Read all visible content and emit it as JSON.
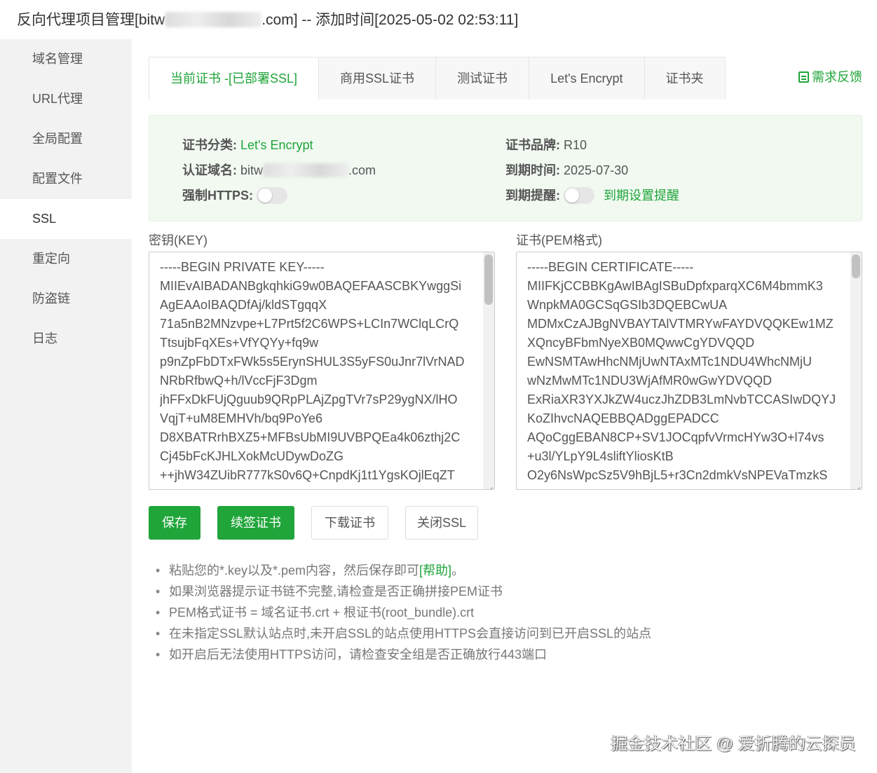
{
  "window": {
    "title_prefix": "反向代理项目管理[bitw",
    "title_suffix": ".com] -- 添加时间[2025-05-02 02:53:11]"
  },
  "sidebar": {
    "items": [
      {
        "label": "域名管理"
      },
      {
        "label": "URL代理"
      },
      {
        "label": "全局配置"
      },
      {
        "label": "配置文件"
      },
      {
        "label": "SSL"
      },
      {
        "label": "重定向"
      },
      {
        "label": "防盗链"
      },
      {
        "label": "日志"
      }
    ],
    "active_index": 4
  },
  "tabs": [
    {
      "label": "当前证书 -[已部署SSL]"
    },
    {
      "label": "商用SSL证书"
    },
    {
      "label": "测试证书"
    },
    {
      "label": "Let's Encrypt"
    },
    {
      "label": "证书夹"
    }
  ],
  "feedback_label": "需求反馈",
  "cert_info": {
    "category_label": "证书分类:",
    "category_value": "Let's Encrypt",
    "brand_label": "证书品牌:",
    "brand_value": "R10",
    "domain_label": "认证域名:",
    "domain_prefix": "bitw",
    "domain_suffix": ".com",
    "expire_label": "到期时间:",
    "expire_value": "2025-07-30",
    "https_label": "强制HTTPS:",
    "https_enabled": false,
    "reminder_label": "到期提醒:",
    "reminder_enabled": false,
    "reminder_link": "到期设置提醒"
  },
  "key_field": {
    "label": "密钥(KEY)",
    "value": "-----BEGIN PRIVATE KEY-----\nMIIEvAIBADANBgkqhkiG9w0BAQEFAASCBKYwggSi\nAgEAAoIBAQDfAj/kldSTgqqX\n71a5nB2MNzvpe+L7Prt5f2C6WPS+LCIn7WClqLCrQ\nTtsujbFqXEs+VfYQYy+fq9w\np9nZpFbDTxFWk5s5ErynSHUL3S5yFS0uJnr7lVrNAD\nNRbRfbwQ+h/lVccFjF3Dgm\njhFFxDkFUjQguub9QRpPLAjZpgTVr7sP29ygNX/lHO\nVqjT+uM8EMHVh/bq9PoYe6\nD8XBATRrhBXZ5+MFBsUbMI9UVBPQEa4k06zthj2C\nCj45bFcKJHLXokMcUDywDoZG\n++jhW34ZUibR777kS0v6Q+CnpdKj1t1YgsKOjlEqZT"
  },
  "cert_field": {
    "label": "证书(PEM格式)",
    "value": "-----BEGIN CERTIFICATE-----\nMIIFKjCCBBKgAwIBAgISBuDpfxparqXC6M4bmmK3\nWnpkMA0GCSqGSIb3DQEBCwUA\nMDMxCzAJBgNVBAYTAlVTMRYwFAYDVQQKEw1MZ\nXQncyBFbmNyeXB0MQwwCgYDVQQD\nEwNSMTAwHhcNMjUwNTAxMTc1NDU4WhcNMjU\nwNzMwMTc1NDU3WjAfMR0wGwYDVQQD\nExRiaXR3YXJkZW4uczJhZDB3LmNvbTCCASIwDQYJ\nKoZIhvcNAQEBBQADggEPADCC\nAQoCggEBAN8CP+SV1JOCqpfvVrmcHYw3O+l74vs\n+u3l/YLpY9L4sliftYliosKtB\nO2y6NsWpcSz5V9hBjL5+r3Cn2dmkVsNPEVaTmzkS"
  },
  "buttons": {
    "save": "保存",
    "renew": "续签证书",
    "download": "下载证书",
    "close_ssl": "关闭SSL"
  },
  "tips": {
    "tip1_text": "粘贴您的*.key以及*.pem内容，然后保存即可",
    "tip1_link": "[帮助]",
    "tip1_end": "。",
    "tip2": "如果浏览器提示证书链不完整,请检查是否正确拼接PEM证书",
    "tip3": "PEM格式证书 = 域名证书.crt + 根证书(root_bundle).crt",
    "tip4": "在未指定SSL默认站点时,未开启SSL的站点使用HTTPS会直接访问到已开启SSL的站点",
    "tip5": "如开启后无法使用HTTPS访问，请检查安全组是否正确放行443端口"
  },
  "watermark": "掘金技术社区 @ 爱折腾的云探员",
  "colors": {
    "accent": "#20a53a",
    "sidebar_bg": "#f2f2f2",
    "panel_bg": "#f1f9f1"
  }
}
